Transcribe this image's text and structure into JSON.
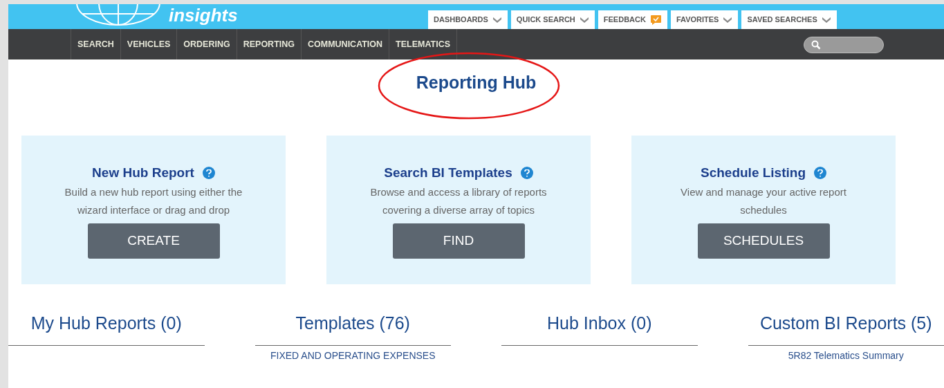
{
  "logo": {
    "text": "insights"
  },
  "top_menu": [
    {
      "label": "DASHBOARDS",
      "kind": "dropdown"
    },
    {
      "label": "QUICK SEARCH",
      "kind": "dropdown"
    },
    {
      "label": "FEEDBACK",
      "kind": "feedback"
    },
    {
      "label": "FAVORITES",
      "kind": "dropdown"
    },
    {
      "label": "SAVED SEARCHES",
      "kind": "dropdown"
    }
  ],
  "nav": [
    "SEARCH",
    "VEHICLES",
    "ORDERING",
    "REPORTING",
    "COMMUNICATION",
    "TELEMATICS"
  ],
  "page_title": "Reporting Hub",
  "cards": [
    {
      "title": "New Hub Report",
      "description": "Build a new hub report using either the wizard interface or drag and drop",
      "button": "CREATE"
    },
    {
      "title": "Search BI Templates",
      "description": "Browse and access a library of reports covering a diverse array of topics",
      "button": "FIND"
    },
    {
      "title": "Schedule Listing",
      "description": "View and manage your active report schedules",
      "button": "SCHEDULES"
    }
  ],
  "sections": [
    {
      "heading": "My Hub Reports (0)"
    },
    {
      "heading": "Templates (76)",
      "items": [
        "FIXED AND OPERATING EXPENSES"
      ]
    },
    {
      "heading": "Hub Inbox (0)"
    },
    {
      "heading": "Custom BI Reports (5)",
      "items": [
        "5R82 Telematics Summary"
      ]
    }
  ]
}
